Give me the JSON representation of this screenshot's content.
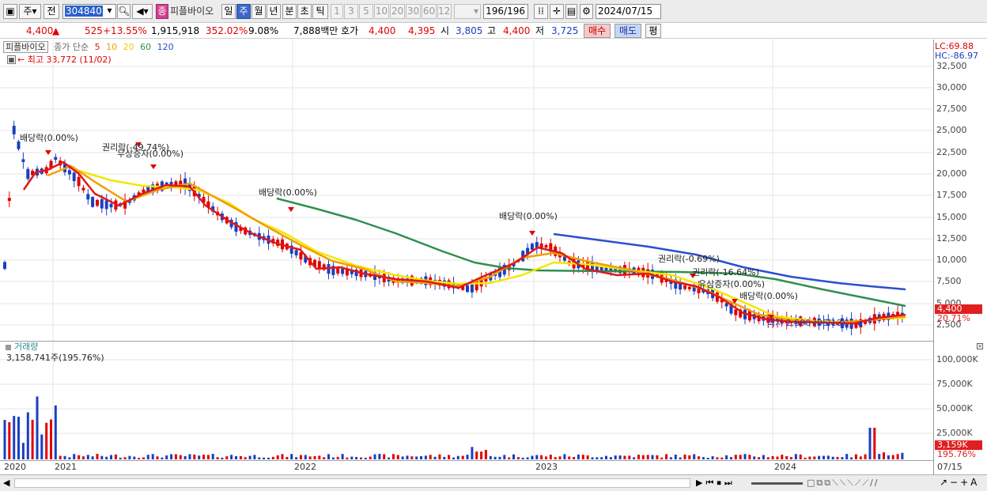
{
  "toolbar": {
    "type_label": "주",
    "prev_label": "전",
    "code_value": "304840",
    "stock_name": "피플바이오",
    "stock_badge": "종",
    "periods": [
      "일",
      "주",
      "월",
      "년",
      "분",
      "초",
      "틱"
    ],
    "selected_period": "주",
    "intervals": [
      "1",
      "3",
      "5",
      "10",
      "20",
      "30",
      "60",
      "120"
    ],
    "count_value": "196/196",
    "date_value": "2024/07/15"
  },
  "quote": {
    "price": "4,400",
    "change": "525",
    "change_pct": "+13.55%",
    "volume": "1,915,918",
    "volume_ratio": "352.02%",
    "turnover": "9.08%",
    "amount": "7,888백만",
    "hoga_label": "호가",
    "hoga_ask": "4,400",
    "hoga_bid": "4,395",
    "open_label": "시",
    "open": "3,805",
    "high_label": "고",
    "high": "4,400",
    "low_label": "저",
    "low": "3,725",
    "buy_label": "매수",
    "sell_label": "매도",
    "even_label": "평"
  },
  "price_panel": {
    "name_tab": "피플바이오",
    "legend": {
      "label": "종가 단순",
      "ma": [
        "5",
        "10",
        "20",
        "60",
        "120"
      ]
    },
    "colors": {
      "ma5": "#e01818",
      "ma10": "#f0a000",
      "ma20": "#f5e600",
      "ma60": "#2f8f4f",
      "ma120": "#2a4fd0",
      "up": "#e00000",
      "down": "#1a3fc0"
    },
    "high_note": "최고 33,772 (11/02)",
    "low_note": "최저 2,590 (05/13)",
    "lc_label": "LC:69.88",
    "hc_label": "HC:-86.97",
    "y_ticks": [
      "32,500",
      "30,000",
      "27,500",
      "25,000",
      "22,500",
      "20,000",
      "17,500",
      "15,000",
      "12,500",
      "10,000",
      "7,500",
      "5,000",
      "2,500"
    ],
    "last_price_tag": "4,400",
    "last_pct_tag": "20.71%",
    "annotations": [
      {
        "text": "배당락(0.00%)"
      },
      {
        "text": "권리락(-49.74%)"
      },
      {
        "text": "무상증자(0.00%)"
      },
      {
        "text": "배당락(0.00%)"
      },
      {
        "text": "배당락(0.00%)"
      },
      {
        "text": "권리락(-0.69%)"
      },
      {
        "text": "권리락(-16.64%)"
      },
      {
        "text": "유상증자(0.00%)"
      },
      {
        "text": "배당락(0.00%)"
      }
    ]
  },
  "volume_panel": {
    "title": "거래량",
    "last_note": "3,158,741주(195.76%)",
    "y_ticks": [
      "100,000K",
      "75,000K",
      "50,000K",
      "25,000K"
    ],
    "last_tag": "3,159K",
    "last_pct_tag": "195.76%"
  },
  "x_axis": {
    "labels": [
      "2020",
      "2021",
      "2022",
      "2023",
      "2024"
    ],
    "end_label": "07/15"
  }
}
